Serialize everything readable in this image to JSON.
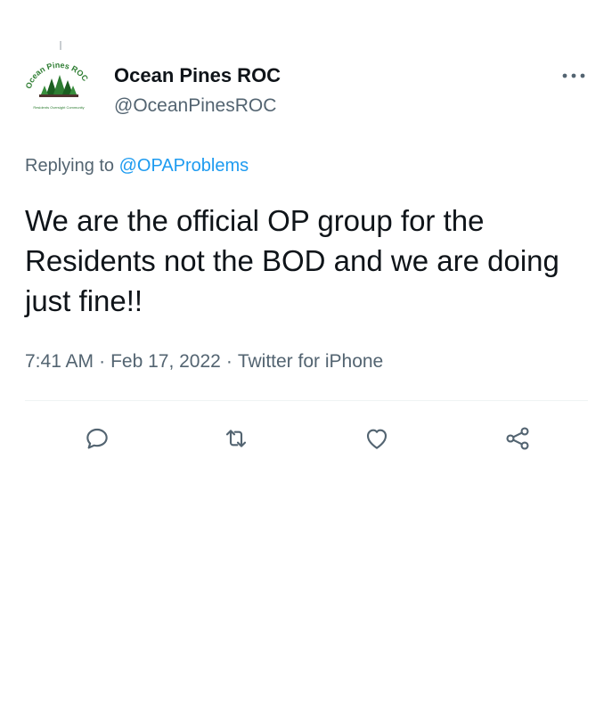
{
  "tweet": {
    "author": {
      "display_name": "Ocean Pines ROC",
      "handle": "@OceanPinesROC",
      "avatar_text": "Ocean Pines ROC",
      "avatar_subtext": "Residents Oversight Community"
    },
    "reply_prefix": "Replying to ",
    "reply_mention": "@OPAProblems",
    "text": "We are the official OP group for the Residents not the BOD and we are doing just fine!!",
    "time": "7:41 AM",
    "separator": "·",
    "date": "Feb 17, 2022",
    "source": "Twitter for iPhone"
  },
  "icons": {
    "more": "more-horizontal-icon",
    "reply": "reply-icon",
    "retweet": "retweet-icon",
    "like": "like-icon",
    "share": "share-icon"
  },
  "colors": {
    "text": "#0f1419",
    "muted": "#536471",
    "link": "#1d9bf0",
    "logo_green": "#2e7d32",
    "divider": "#eff3f4"
  }
}
